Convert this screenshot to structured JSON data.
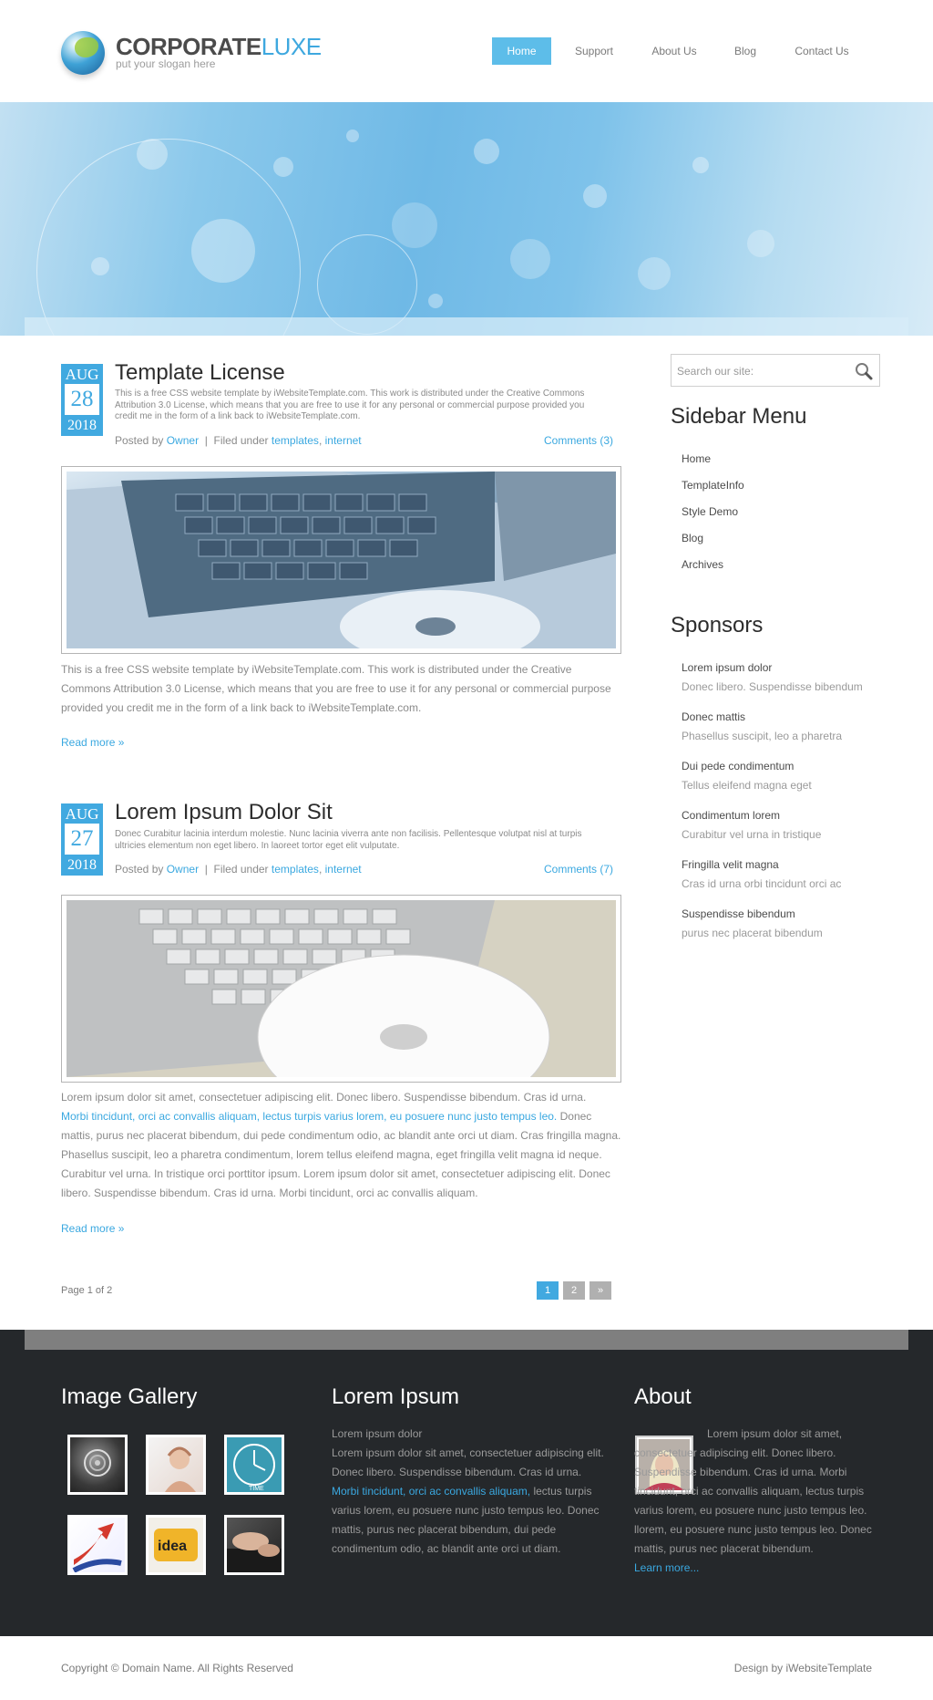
{
  "header": {
    "logo_text_bold": "CORPORATE",
    "logo_text_light": "LUXE",
    "slogan": "put your slogan here",
    "nav": [
      "Home",
      "Support",
      "About Us",
      "Blog",
      "Contact Us"
    ],
    "active_nav": "Home"
  },
  "posts": [
    {
      "month": "Aug",
      "day": "28",
      "year": "2018",
      "title": "Template License",
      "excerpt": "This is a free CSS website template by iWebsiteTemplate.com. This work is distributed under the Creative Commons Attribution 3.0 License, which means that you are free to use it for any personal or commercial purpose provided you credit me in the form of a link back to iWebsiteTemplate.com.",
      "posted_by_label": "Posted by",
      "author": "Owner",
      "filed_under_label": "Filed under",
      "category_1": "templates",
      "category_2": "internet",
      "comments": "Comments (3)",
      "body": "This is a free CSS website template by iWebsiteTemplate.com. This work is distributed under the Creative Commons Attribution 3.0 License, which means that you are free to use it for any personal or commercial purpose provided you credit me in the form of a link back to iWebsiteTemplate.com.",
      "read_more": "Read more »"
    },
    {
      "month": "Aug",
      "day": "27",
      "year": "2018",
      "title": "Lorem Ipsum Dolor Sit",
      "excerpt": "Donec Curabitur lacinia interdum molestie. Nunc lacinia viverra ante non facilisis. Pellentesque volutpat nisl at turpis ultricies elementum non eget libero. In laoreet tortor eget elit vulputate.",
      "posted_by_label": "Posted by",
      "author": "Owner",
      "filed_under_label": "Filed under",
      "category_1": "templates",
      "category_2": "internet",
      "comments": "Comments (7)",
      "body_start": "Lorem ipsum dolor sit amet, consectetuer adipiscing elit. Donec libero. Suspendisse bibendum. Cras id urna.",
      "body_link": "Morbi tincidunt, orci ac convallis aliquam, lectus turpis varius lorem, eu posuere nunc justo tempus leo.",
      "body_end": "Donec mattis, purus nec placerat bibendum, dui pede condimentum odio, ac blandit ante orci ut diam. Cras fringilla magna. Phasellus suscipit, leo a pharetra condimentum, lorem tellus eleifend magna, eget fringilla velit magna id neque. Curabitur vel urna. In tristique orci porttitor ipsum. Lorem ipsum dolor sit amet, consectetuer adipiscing elit. Donec libero. Suspendisse bibendum. Cras id urna. Morbi tincidunt, orci ac convallis aliquam.",
      "read_more": "Read more »"
    }
  ],
  "pagination": {
    "info": "Page 1 of 2",
    "pages": [
      "1",
      "2"
    ],
    "next": "»"
  },
  "sidebar": {
    "search_placeholder": "Search our site:",
    "menu_title": "Sidebar Menu",
    "menu": [
      "Home",
      "TemplateInfo",
      "Style Demo",
      "Blog",
      "Archives"
    ],
    "sponsors_title": "Sponsors",
    "sponsors": [
      {
        "title": "Lorem ipsum dolor",
        "sub": "Donec libero. Suspendisse bibendum"
      },
      {
        "title": "Donec mattis",
        "sub": "Phasellus suscipit, leo a pharetra"
      },
      {
        "title": "Dui pede condimentum",
        "sub": "Tellus eleifend magna eget"
      },
      {
        "title": "Condimentum lorem",
        "sub": "Curabitur vel urna in tristique"
      },
      {
        "title": "Fringilla velit magna",
        "sub": "Cras id urna orbi tincidunt orci ac"
      },
      {
        "title": "Suspendisse bibendum",
        "sub": "purus nec placerat bibendum"
      }
    ]
  },
  "footer": {
    "gallery_title": "Image Gallery",
    "lorem_title": "Lorem Ipsum",
    "lorem_line1": "Lorem ipsum dolor",
    "lorem_text": "Lorem ipsum dolor sit amet, consectetuer adipiscing elit. Donec libero. Suspendisse bibendum. Cras id urna.",
    "lorem_link": "Morbi tincidunt, orci ac convallis aliquam,",
    "lorem_text2": "lectus turpis varius lorem, eu posuere nunc justo tempus leo. Donec mattis, purus nec placerat bibendum, dui pede condimentum odio, ac blandit ante orci ut diam.",
    "about_title": "About",
    "about_text": "Lorem ipsum dolor sit amet, consectetuer adipiscing elit. Donec libero. Suspendisse bibendum. Cras id urna. Morbi tincidunt, orci ac convallis aliquam, lectus turpis varius lorem, eu posuere nunc justo tempus leo. llorem, eu posuere nunc justo tempus leo. Donec mattis, purus nec placerat bibendum.",
    "about_link": "Learn more...",
    "thumb_idea": "idea",
    "thumb_time": "TIME",
    "copyright_prefix": "Copyright ©",
    "domain": "Domain Name",
    "copyright_suffix": ". All Rights Reserved",
    "design_label": "Design by",
    "design_link": "iWebsiteTemplate"
  },
  "colors": {
    "accent": "#41a9e0",
    "nav_active": "#5dbde9",
    "footer_bg": "#25282b",
    "footer_bar": "#7f7f7f"
  }
}
